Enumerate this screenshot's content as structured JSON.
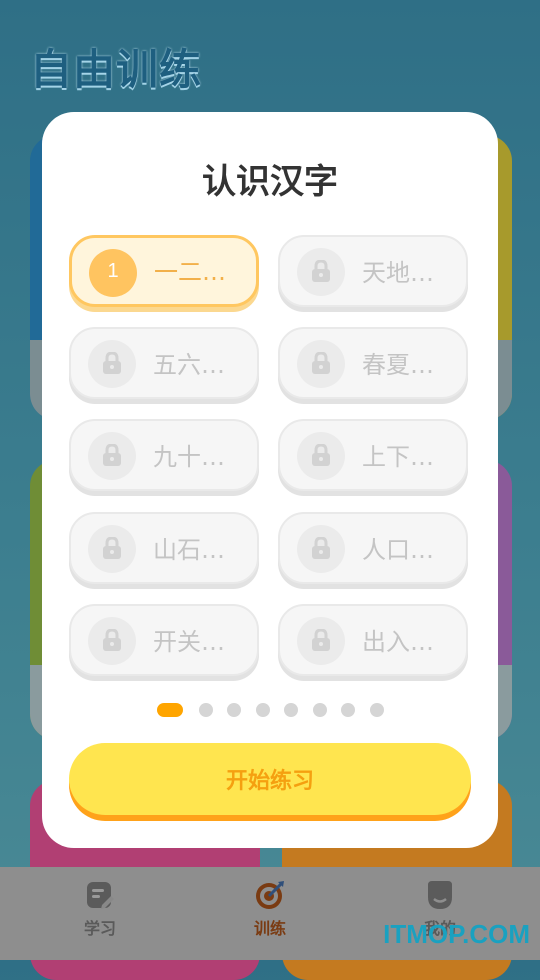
{
  "page": {
    "title": "自由训练"
  },
  "dialog": {
    "title": "认识汉字",
    "lessons": [
      {
        "label": "一二…",
        "number": "1",
        "locked": false,
        "selected": true
      },
      {
        "label": "天地…",
        "locked": true
      },
      {
        "label": "五六…",
        "locked": true
      },
      {
        "label": "春夏…",
        "locked": true
      },
      {
        "label": "九十…",
        "locked": true
      },
      {
        "label": "上下…",
        "locked": true
      },
      {
        "label": "山石…",
        "locked": true
      },
      {
        "label": "人口…",
        "locked": true
      },
      {
        "label": "开关…",
        "locked": true
      },
      {
        "label": "出入…",
        "locked": true
      }
    ],
    "pagination": {
      "total_pages": 8,
      "current_page": 1
    },
    "start_button": "开始练习"
  },
  "bottom_nav": {
    "items": [
      {
        "label": "学习",
        "icon": "study-icon",
        "active": false
      },
      {
        "label": "训练",
        "icon": "target-icon",
        "active": true
      },
      {
        "label": "我的",
        "icon": "profile-icon",
        "active": false
      }
    ]
  },
  "watermark": "ITMOP.COM",
  "colors": {
    "accent": "#ffa500",
    "button": "#ffe54f",
    "selected": "#ffc460"
  }
}
